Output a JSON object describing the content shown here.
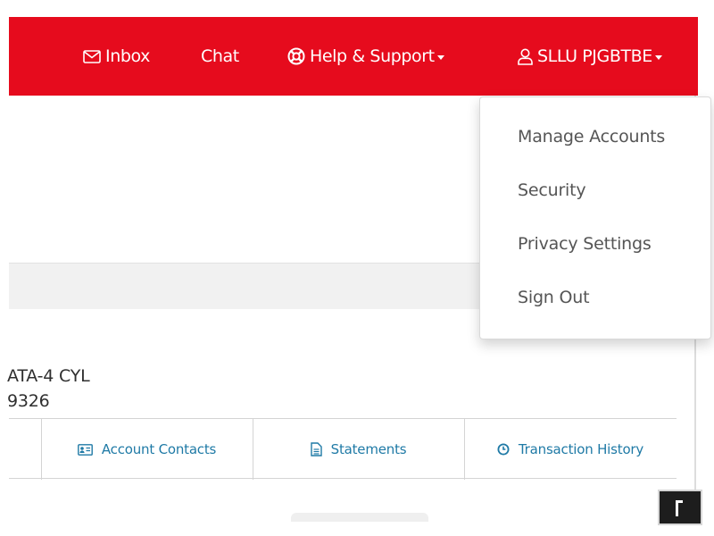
{
  "colors": {
    "brand_red": "#e60b1d",
    "link_blue": "#1f7aa6"
  },
  "topnav": {
    "inbox": {
      "label": "Inbox",
      "icon": "envelope-icon"
    },
    "chat": {
      "label": "Chat"
    },
    "help": {
      "label": "Help & Support",
      "icon": "lifebuoy-icon"
    },
    "user": {
      "label": "SLLU PJGBTBE",
      "icon": "user-icon"
    }
  },
  "user_menu": {
    "items": [
      {
        "label": "Manage Accounts"
      },
      {
        "label": "Security"
      },
      {
        "label": "Privacy Settings"
      },
      {
        "label": "Sign Out"
      }
    ]
  },
  "vehicle": {
    "line1": "ATA-4 CYL",
    "line2": "9326"
  },
  "account_tabs": [
    {
      "label": "Account Contacts",
      "icon": "contact-card-icon"
    },
    {
      "label": "Statements",
      "icon": "document-icon"
    },
    {
      "label": "Transaction History",
      "icon": "clock-icon"
    }
  ]
}
